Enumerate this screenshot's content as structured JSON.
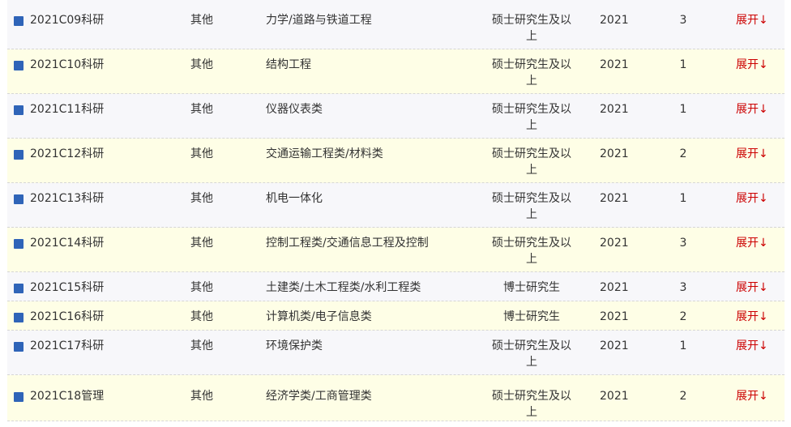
{
  "toggle_label": "展开↓",
  "colors": {
    "odd_row": "#f7f7fa",
    "even_row": "#fefee6",
    "bullet": "#2f64b8",
    "toggle": "#cc0000"
  },
  "rows": [
    {
      "title": "2021C09科研",
      "type": "其他",
      "major": "力学/道路与铁道工程",
      "education": "硕士研究生及以上",
      "year": "2021",
      "count": "3"
    },
    {
      "title": "2021C10科研",
      "type": "其他",
      "major": "结构工程",
      "education": "硕士研究生及以上",
      "year": "2021",
      "count": "1"
    },
    {
      "title": "2021C11科研",
      "type": "其他",
      "major": "仪器仪表类",
      "education": "硕士研究生及以上",
      "year": "2021",
      "count": "1"
    },
    {
      "title": "2021C12科研",
      "type": "其他",
      "major": "交通运输工程类/材料类",
      "education": "硕士研究生及以上",
      "year": "2021",
      "count": "2"
    },
    {
      "title": "2021C13科研",
      "type": "其他",
      "major": "机电一体化",
      "education": "硕士研究生及以上",
      "year": "2021",
      "count": "1"
    },
    {
      "title": "2021C14科研",
      "type": "其他",
      "major": "控制工程类/交通信息工程及控制",
      "education": "硕士研究生及以上",
      "year": "2021",
      "count": "3"
    },
    {
      "title": "2021C15科研",
      "type": "其他",
      "major": "土建类/土木工程类/水利工程类",
      "education": "博士研究生",
      "year": "2021",
      "count": "3"
    },
    {
      "title": "2021C16科研",
      "type": "其他",
      "major": "计算机类/电子信息类",
      "education": "博士研究生",
      "year": "2021",
      "count": "2"
    },
    {
      "title": "2021C17科研",
      "type": "其他",
      "major": "环境保护类",
      "education": "硕士研究生及以上",
      "year": "2021",
      "count": "1"
    },
    {
      "title": "2021C18管理",
      "type": "其他",
      "major": "经济学类/工商管理类",
      "education": "硕士研究生及以上",
      "year": "2021",
      "count": "2"
    }
  ]
}
